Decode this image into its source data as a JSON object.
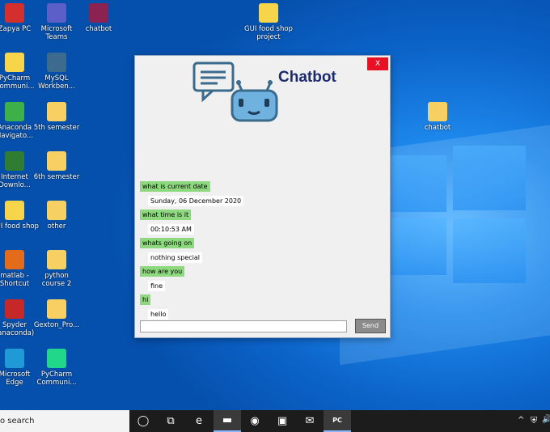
{
  "desktop": {
    "icons": [
      {
        "label": "Zapya PC",
        "icon": "zapya-icon",
        "color": "#d32f2f"
      },
      {
        "label": "Microsoft Teams",
        "icon": "teams-icon",
        "color": "#5b5fc7"
      },
      {
        "label": "chatbot",
        "icon": "winrar-icon",
        "color": "#8b2252"
      },
      {
        "label": "GUI food shop project",
        "icon": "python-file-icon",
        "color": "#f7d54b"
      },
      {
        "label": "PyCharm Communi...",
        "icon": "python-file-icon",
        "color": "#f7d54b"
      },
      {
        "label": "MySQL Workben...",
        "icon": "mysql-icon",
        "color": "#3d6b8e"
      },
      {
        "label": "Anaconda Navigato...",
        "icon": "anaconda-icon",
        "color": "#3eb049"
      },
      {
        "label": "5th semester",
        "icon": "folder-icon",
        "color": "#f7d064"
      },
      {
        "label": "chatbot",
        "icon": "folder-icon",
        "color": "#f7d064"
      },
      {
        "label": "Internet Downlo...",
        "icon": "idm-icon",
        "color": "#2e7d32"
      },
      {
        "label": "6th semester",
        "icon": "folder-icon",
        "color": "#f7d064"
      },
      {
        "label": "GUI food shop",
        "icon": "python-file-icon",
        "color": "#f7d54b"
      },
      {
        "label": "other",
        "icon": "folder-icon",
        "color": "#f7d064"
      },
      {
        "label": "matlab - Shortcut",
        "icon": "matlab-icon",
        "color": "#e36b1c"
      },
      {
        "label": "python course 2",
        "icon": "folder-icon",
        "color": "#f7d064"
      },
      {
        "label": "Spyder (anaconda)",
        "icon": "spyder-icon",
        "color": "#c62828"
      },
      {
        "label": "Gexton_Pro...",
        "icon": "folder-icon",
        "color": "#f7d064"
      },
      {
        "label": "Microsoft Edge",
        "icon": "edge-icon",
        "color": "#1f9ad6"
      },
      {
        "label": "PyCharm Communi...",
        "icon": "pycharm-icon",
        "color": "#21d789"
      }
    ]
  },
  "chatbot": {
    "title": "Chatbot",
    "close_label": "X",
    "messages": [
      {
        "who": "user",
        "text": "what is current date"
      },
      {
        "who": "bot",
        "text": "Sunday, 06 December 2020"
      },
      {
        "who": "user",
        "text": "what time is it"
      },
      {
        "who": "bot",
        "text": "00:10:53 AM"
      },
      {
        "who": "user",
        "text": "whats going on"
      },
      {
        "who": "bot",
        "text": "nothing special"
      },
      {
        "who": "user",
        "text": "how are you"
      },
      {
        "who": "bot",
        "text": "fine"
      },
      {
        "who": "user",
        "text": "hi"
      },
      {
        "who": "bot",
        "text": "hello"
      }
    ],
    "input_value": "",
    "send_label": "Send"
  },
  "taskbar": {
    "search_text": "o search",
    "apps": [
      {
        "icon": "task-view-circle-icon",
        "glyph": "◯"
      },
      {
        "icon": "task-view-icon",
        "glyph": "⧉"
      },
      {
        "icon": "edge-icon",
        "glyph": "e"
      },
      {
        "icon": "file-explorer-icon",
        "glyph": "▬"
      },
      {
        "icon": "chrome-icon",
        "glyph": "◉"
      },
      {
        "icon": "store-icon",
        "glyph": "▣"
      },
      {
        "icon": "mail-icon",
        "glyph": "✉"
      },
      {
        "icon": "pycharm-icon",
        "glyph": "PC"
      }
    ],
    "tray": {
      "up_arrow": "^",
      "shield": "⛨",
      "speaker": "🔊"
    }
  }
}
